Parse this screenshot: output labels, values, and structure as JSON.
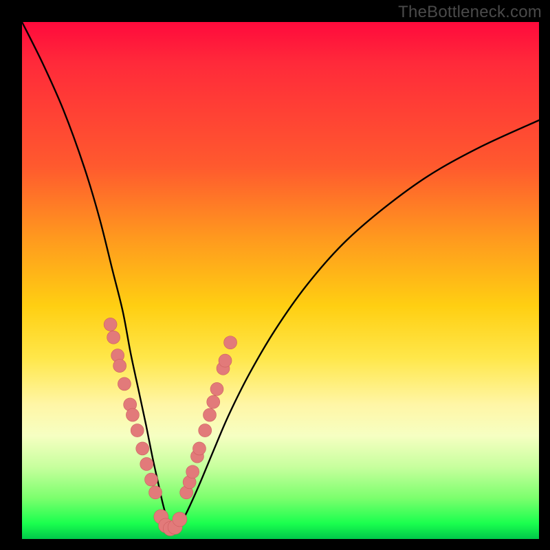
{
  "watermark": "TheBottleneck.com",
  "colors": {
    "curve_stroke": "#000000",
    "marker_fill": "#e27a7a",
    "marker_stroke": "#cc5f5f"
  },
  "chart_data": {
    "type": "line",
    "title": "",
    "xlabel": "",
    "ylabel": "",
    "xlim": [
      0,
      100
    ],
    "ylim": [
      0,
      100
    ],
    "series": [
      {
        "name": "bottleneck-curve",
        "x": [
          0,
          4,
          8,
          12,
          15,
          17.5,
          19.5,
          21,
          22.5,
          24,
          25.2,
          26.3,
          27.2,
          28,
          28.6,
          29.8,
          31,
          32.5,
          34.5,
          37,
          40,
          44,
          49,
          55,
          62,
          70,
          79,
          89,
          100
        ],
        "y": [
          100,
          92,
          83,
          72,
          62,
          52,
          44,
          36,
          29,
          22,
          16,
          11,
          7,
          4,
          2,
          2,
          3.5,
          6.5,
          11,
          17,
          24,
          32,
          40.5,
          49,
          57,
          64,
          70.5,
          76,
          81
        ]
      }
    ],
    "markers": {
      "left_branch": [
        {
          "x": 17.1,
          "y": 41.5
        },
        {
          "x": 17.7,
          "y": 39
        },
        {
          "x": 18.5,
          "y": 35.5
        },
        {
          "x": 18.9,
          "y": 33.5
        },
        {
          "x": 19.8,
          "y": 30
        },
        {
          "x": 20.9,
          "y": 26
        },
        {
          "x": 21.4,
          "y": 24
        },
        {
          "x": 22.3,
          "y": 21
        },
        {
          "x": 23.3,
          "y": 17.5
        },
        {
          "x": 24.1,
          "y": 14.5
        },
        {
          "x": 25.0,
          "y": 11.5
        },
        {
          "x": 25.8,
          "y": 9
        }
      ],
      "right_branch": [
        {
          "x": 31.8,
          "y": 9
        },
        {
          "x": 32.4,
          "y": 11
        },
        {
          "x": 33.0,
          "y": 13
        },
        {
          "x": 33.9,
          "y": 16
        },
        {
          "x": 34.3,
          "y": 17.5
        },
        {
          "x": 35.4,
          "y": 21
        },
        {
          "x": 36.3,
          "y": 24
        },
        {
          "x": 37.0,
          "y": 26.5
        },
        {
          "x": 37.7,
          "y": 29
        },
        {
          "x": 38.9,
          "y": 33
        },
        {
          "x": 39.3,
          "y": 34.5
        },
        {
          "x": 40.3,
          "y": 38
        }
      ],
      "bottom_row": [
        {
          "x": 26.9,
          "y": 4.3
        },
        {
          "x": 27.8,
          "y": 2.6
        },
        {
          "x": 28.7,
          "y": 2.0
        },
        {
          "x": 29.6,
          "y": 2.3
        },
        {
          "x": 30.5,
          "y": 3.8
        }
      ]
    }
  }
}
